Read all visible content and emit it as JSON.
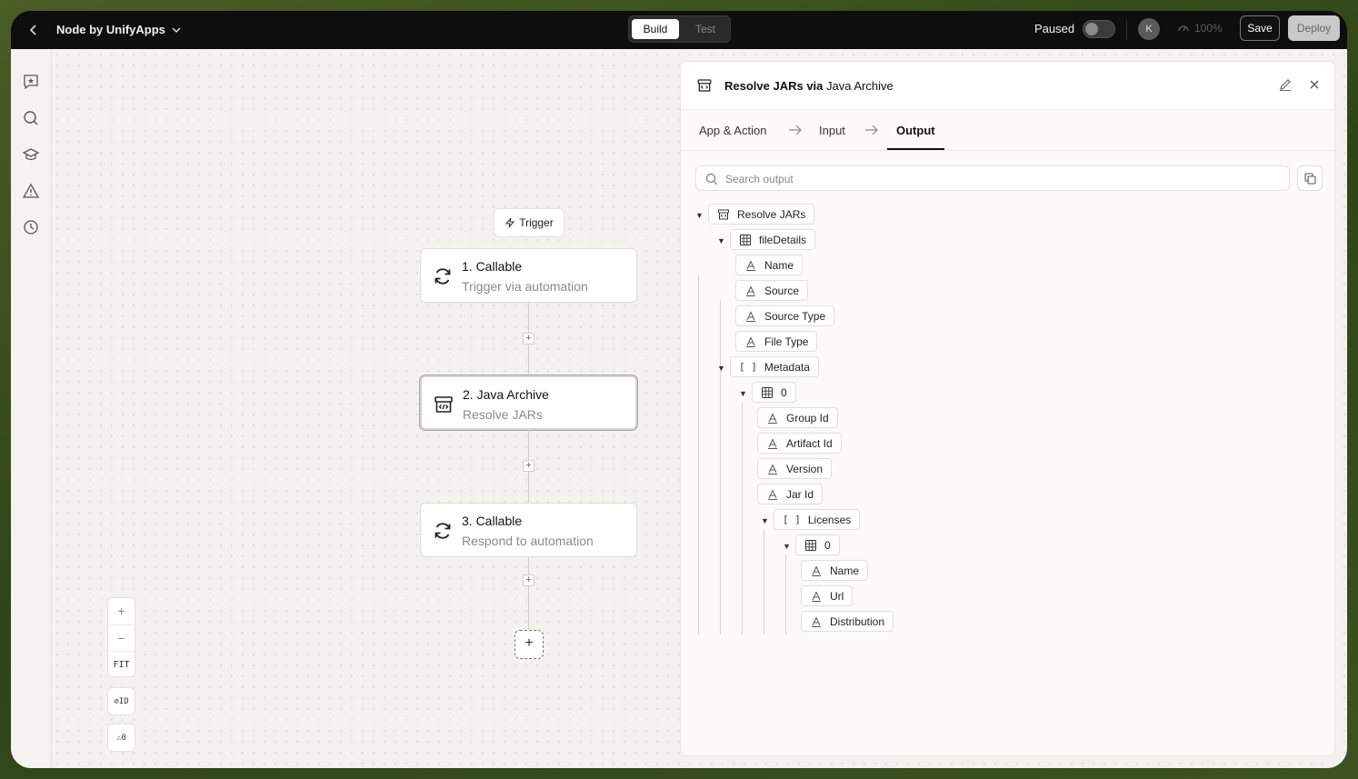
{
  "topbar": {
    "app_name": "Node by UnifyApps",
    "mode_build": "Build",
    "mode_test": "Test",
    "status_label": "Paused",
    "avatar_initial": "K",
    "zoom_readout": "100%",
    "save_label": "Save",
    "deploy_label": "Deploy"
  },
  "canvas": {
    "trigger_label": "Trigger",
    "nodes": [
      {
        "title": "1. Callable",
        "subtitle": "Trigger via automation"
      },
      {
        "title": "2. Java Archive",
        "subtitle": "Resolve JARs"
      },
      {
        "title": "3. Callable",
        "subtitle": "Respond to automation"
      }
    ],
    "zoom_in": "+",
    "zoom_out": "−",
    "fit_label": "FIT",
    "id_toggle_label": "ID",
    "warnings_label": "0"
  },
  "panel": {
    "title_bold": "Resolve JARs via",
    "title_rest": "Java Archive",
    "tabs": [
      "App & Action",
      "Input",
      "Output"
    ],
    "active_tab": "Output",
    "search_placeholder": "Search output",
    "tree": {
      "root": "Resolve JARs",
      "fileDetails": "fileDetails",
      "file_fields": [
        "Name",
        "Source",
        "Source Type",
        "File Type"
      ],
      "metadata": "Metadata",
      "metadata_index": "0",
      "meta_fields": [
        "Group Id",
        "Artifact Id",
        "Version",
        "Jar Id"
      ],
      "licenses": "Licenses",
      "licenses_index": "0",
      "license_fields": [
        "Name",
        "Url",
        "Distribution"
      ]
    }
  },
  "colors": {
    "topbar_bg": "#0e0e0e",
    "canvas_bg": "#f3f2ef",
    "deploy_bg": "#c9c9c9",
    "active_tab_underline": "#111111"
  },
  "icons": {
    "left_rail": [
      "ai-chat-icon",
      "search-icon",
      "learn-icon",
      "warning-icon",
      "history-icon"
    ]
  }
}
